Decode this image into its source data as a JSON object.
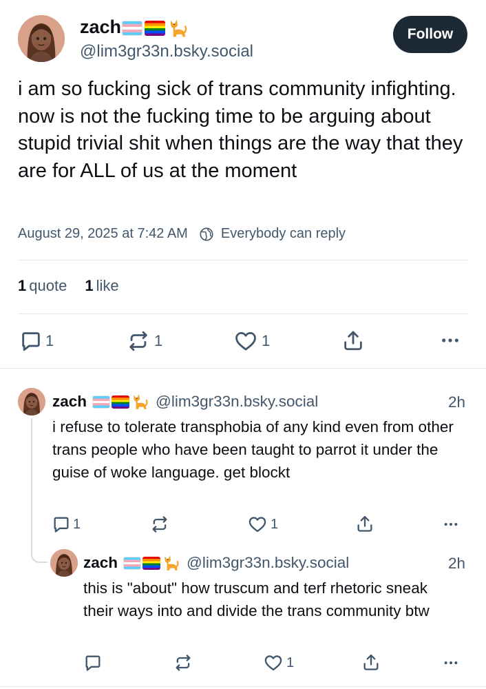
{
  "main_post": {
    "author_name": "zach",
    "author_handle": "@lim3gr33n.bsky.social",
    "follow_label": "Follow",
    "text": "i am so fucking sick of trans community infighting. now is not the fucking time to be arguing about stupid trivial shit when things are the way that they are for ALL of us at the moment",
    "timestamp": "August 29, 2025 at 7:42 AM",
    "reply_setting": "Everybody can reply",
    "stats": {
      "quotes_count": "1",
      "quotes_label": "quote",
      "likes_count": "1",
      "likes_label": "like"
    },
    "actions": {
      "reply_count": "1",
      "repost_count": "1",
      "like_count": "1"
    }
  },
  "replies": [
    {
      "author_name": "zach",
      "author_handle": "@lim3gr33n.bsky.social",
      "time": "2h",
      "text": "i refuse to tolerate transphobia of any kind even from other trans people who have been taught to parrot it under the guise of woke language. get blockt",
      "actions": {
        "reply_count": "1",
        "repost_count": "",
        "like_count": "1"
      }
    },
    {
      "author_name": "zach",
      "author_handle": "@lim3gr33n.bsky.social",
      "time": "2h",
      "text": "this is \"about\" how truscum and terf rhetoric sneak their ways into and divide the trans community btw",
      "actions": {
        "reply_count": "",
        "repost_count": "",
        "like_count": "1"
      }
    }
  ],
  "icons": [
    "trans-flag-icon",
    "rainbow-flag-icon",
    "cat-icon",
    "globe-icon",
    "reply-icon",
    "repost-icon",
    "heart-icon",
    "share-icon",
    "more-icon"
  ],
  "colors": {
    "primary_text": "#0b0f14",
    "secondary_text": "#42576c",
    "follow_bg": "#1e2936",
    "divider": "#e4e8ec"
  }
}
